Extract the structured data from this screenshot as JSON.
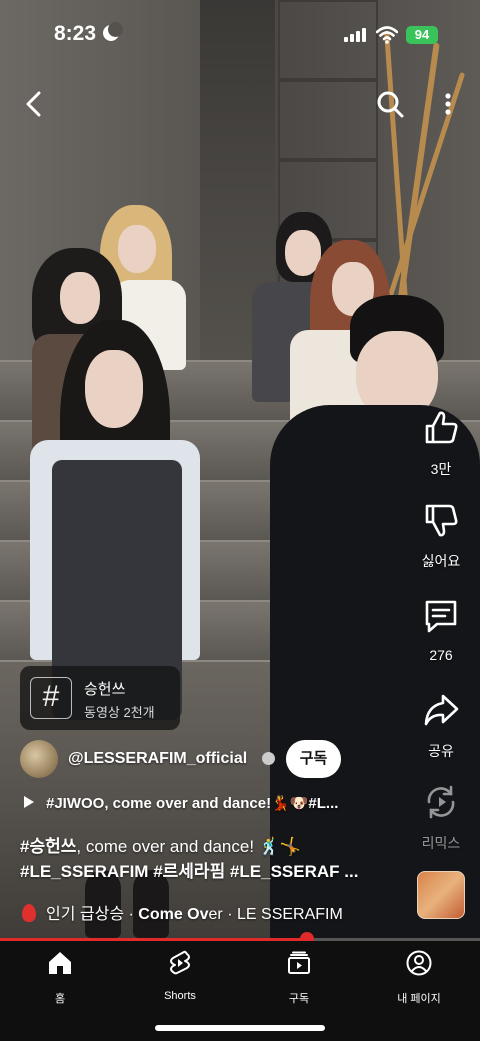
{
  "status_bar": {
    "time": "8:23",
    "battery": "94"
  },
  "actions": {
    "like_count": "3만",
    "dislike_label": "싫어요",
    "comment_count": "276",
    "share_label": "공유",
    "remix_label": "리믹스"
  },
  "hashtag_card": {
    "symbol": "#",
    "title": "승헌쓰",
    "subtitle": "동영상 2천개"
  },
  "channel": {
    "name": "@LESSERAFIM_official",
    "subscribe_label": "구독"
  },
  "playlist_line": "#JIWOO, come over and dance!💃🐶#L...",
  "description": {
    "line1_tag": "#승헌쓰",
    "line1_rest": ", come over and dance! 🕺🤸",
    "line2": "#LE_SSERAFIM #르세라핌 #LE_SSERAF ..."
  },
  "music": {
    "trending_label": "인기 급상승",
    "sep": "·",
    "song_bold": "Come Ov",
    "song_rest": "er",
    "artist_sep": "·",
    "artist": "LE SSERAFIM"
  },
  "progress": {
    "fraction": 0.64
  },
  "nav": [
    {
      "label": "홈",
      "icon": "home-icon"
    },
    {
      "label": "Shorts",
      "icon": "shorts-icon"
    },
    {
      "label": "구독",
      "icon": "subscriptions-icon"
    },
    {
      "label": "내 페이지",
      "icon": "profile-icon"
    }
  ],
  "colors": {
    "accent": "#e12a2a",
    "battery": "#3ac35a",
    "nav_bg": "#0f0f0f"
  }
}
